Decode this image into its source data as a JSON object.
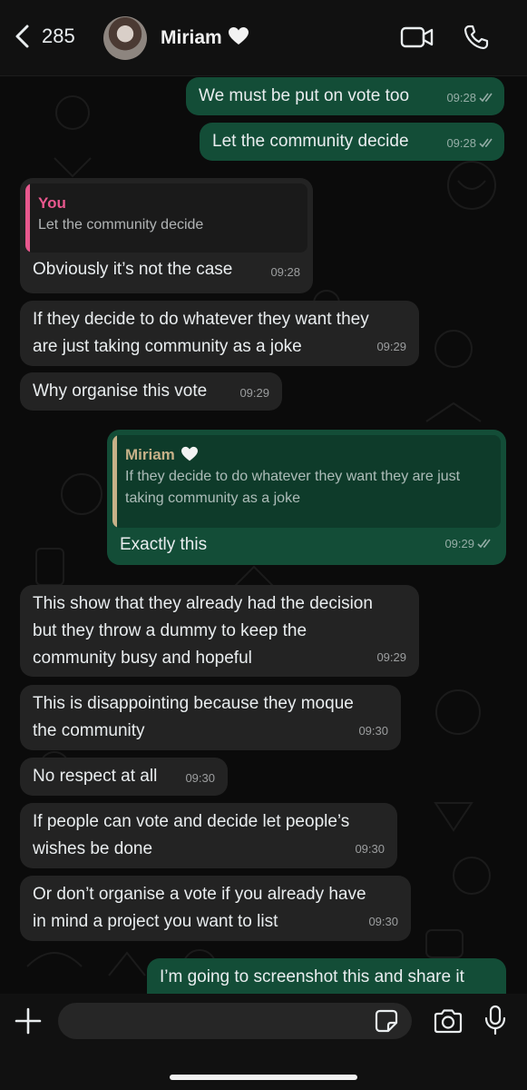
{
  "header": {
    "back_count": "285",
    "contact_name": "Miriam",
    "video_icon": "video-camera-icon",
    "call_icon": "phone-icon"
  },
  "messages": [
    {
      "text": "We must be put on vote too",
      "time": "09:28",
      "direction": "outgoing",
      "status": "read"
    },
    {
      "text": "Let the community decide",
      "time": "09:28",
      "direction": "outgoing",
      "status": "read"
    },
    {
      "quote_author": "You",
      "quote_text": "Let the community decide",
      "text": "Obviously it’s not the case",
      "time": "09:28",
      "direction": "incoming"
    },
    {
      "text": "If they decide to do whatever they want they are just taking community as a joke",
      "line1": "If they decide to do whatever they want they",
      "line2": "are just taking community as a joke",
      "time": "09:29",
      "direction": "incoming"
    },
    {
      "text": "Why organise this vote",
      "time": "09:29",
      "direction": "incoming"
    },
    {
      "quote_author": "Miriam",
      "quote_line1": "If they decide to do whatever they want they are just",
      "quote_line2": "taking community as a joke",
      "text": "Exactly this",
      "time": "09:29",
      "direction": "outgoing",
      "status": "read"
    },
    {
      "line1": "This show that they already had the decision",
      "line2": "but they throw a dummy to keep the",
      "line3": "community busy and hopeful",
      "time": "09:29",
      "direction": "incoming"
    },
    {
      "line1": "This is disappointing because they moque",
      "line2": "the community",
      "time": "09:30",
      "direction": "incoming"
    },
    {
      "text": "No respect at all",
      "time": "09:30",
      "direction": "incoming"
    },
    {
      "line1": "If people can vote and decide let people’s",
      "line2": "wishes be done",
      "time": "09:30",
      "direction": "incoming"
    },
    {
      "line1": "Or don’t organise a vote if you already have",
      "line2": "in mind a project you want to list",
      "time": "09:30",
      "direction": "incoming"
    },
    {
      "text": "I’m going to screenshot this and share it",
      "direction": "outgoing"
    }
  ],
  "colors": {
    "outgoing_bubble": "#134d37",
    "incoming_bubble": "#232323",
    "quote_you_bar": "#e8588e",
    "quote_miriam_bar": "#c7b188"
  },
  "bottom_bar": {
    "icons": [
      "plus-icon",
      "sticker-icon",
      "camera-icon",
      "microphone-icon"
    ]
  }
}
